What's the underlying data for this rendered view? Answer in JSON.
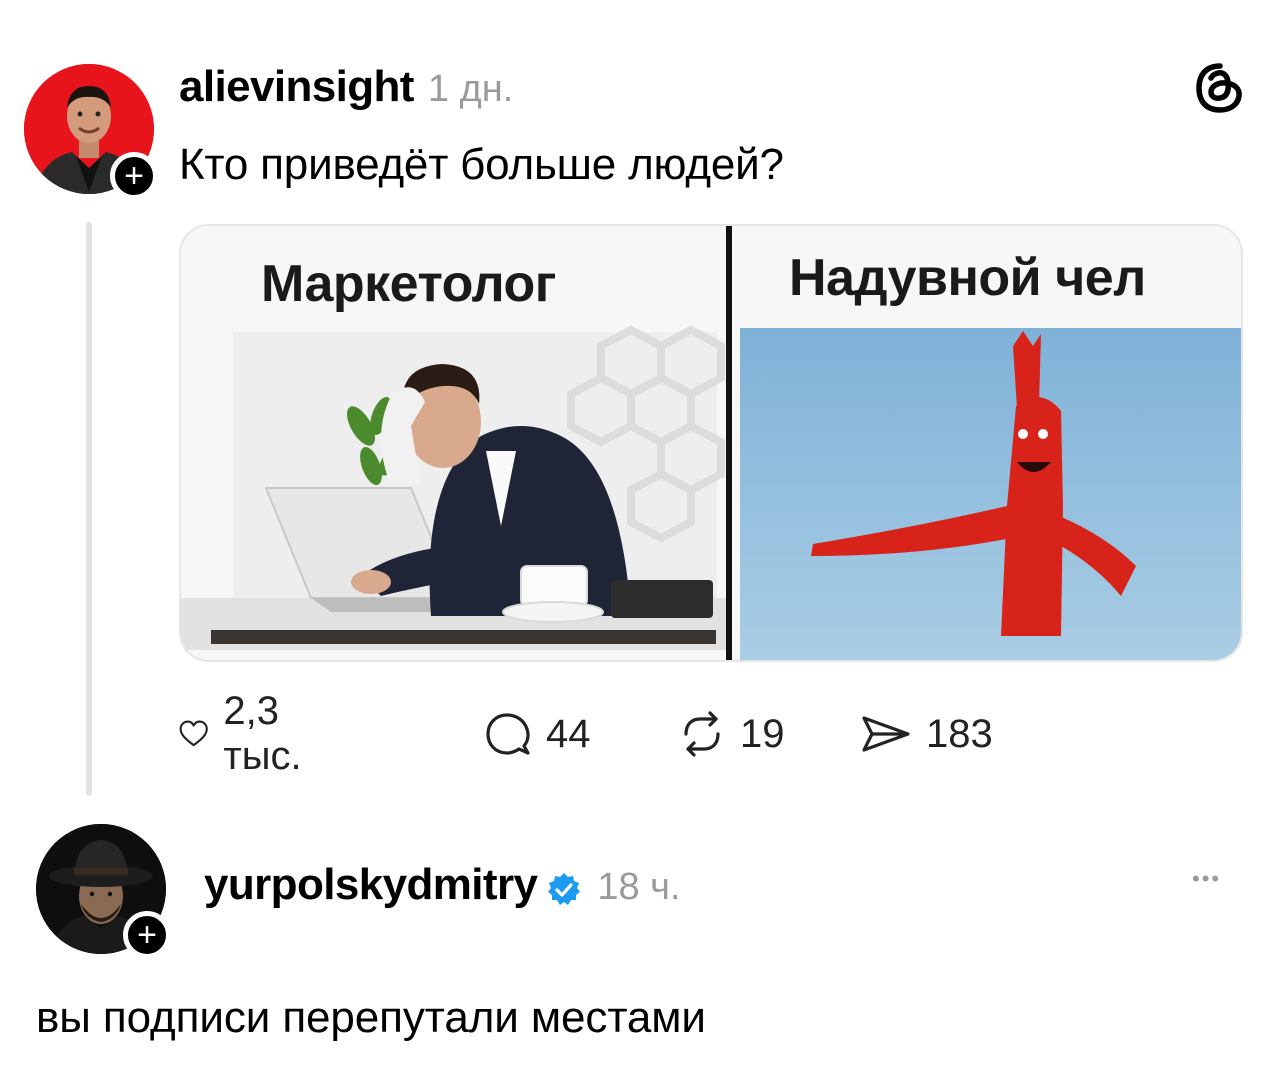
{
  "post": {
    "username": "alievinsight",
    "time": "1 дн.",
    "text": "Кто приведёт больше людей?",
    "follow_symbol": "+",
    "media": {
      "left_label": "Маркетолог",
      "right_label": "Надувной чел"
    },
    "actions": {
      "likes": "2,3 тыс.",
      "comments": "44",
      "reposts": "19",
      "shares": "183"
    }
  },
  "reply": {
    "username": "yurpolskydmitry",
    "verified": true,
    "time": "18 ч.",
    "text": "вы подписи перепутали местами",
    "follow_symbol": "+",
    "more_symbol": "•••"
  },
  "colors": {
    "avatar1_bg": "#e8141b",
    "verified": "#1d9bf0",
    "thread_line": "#e3e3e3",
    "muted_text": "#9a9a9a"
  }
}
